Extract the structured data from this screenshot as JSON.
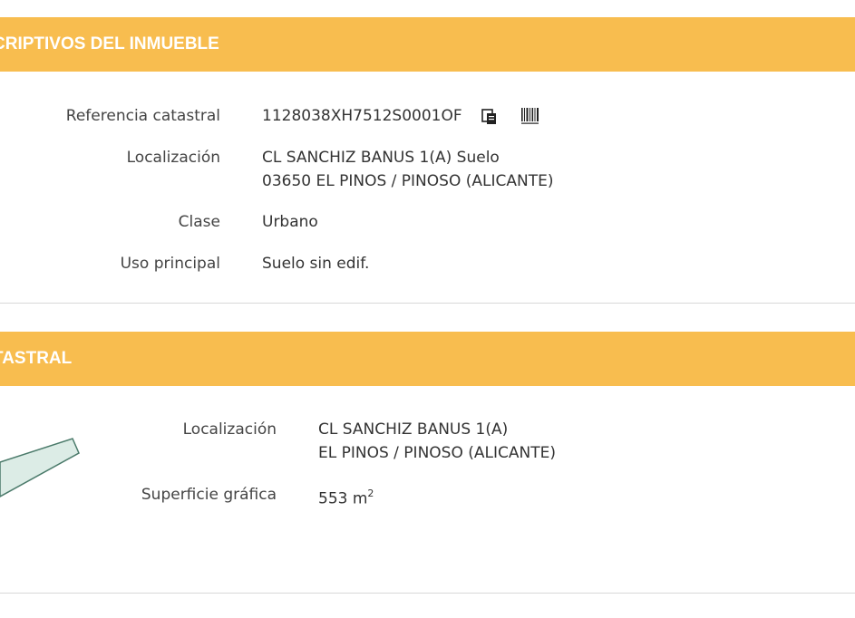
{
  "section1": {
    "title": "CRIPTIVOS DEL INMUEBLE",
    "rows": [
      {
        "label": "Referencia catastral",
        "value": "1128038XH7512S0001OF"
      },
      {
        "label": "Localización",
        "value_line1": "CL SANCHIZ BANUS 1(A) Suelo",
        "value_line2": "03650 EL PINOS / PINOSO (ALICANTE)"
      },
      {
        "label": "Clase",
        "value": "Urbano"
      },
      {
        "label": "Uso principal",
        "value": "Suelo sin edif."
      }
    ],
    "icons": [
      "copy-icon",
      "barcode-icon"
    ]
  },
  "section2": {
    "title": "TASTRAL",
    "rows": [
      {
        "label": "Localización",
        "value_line1": "CL SANCHIZ BANUS 1(A)",
        "value_line2": "EL PINOS / PINOSO (ALICANTE)"
      },
      {
        "label": "Superficie gráfica",
        "value": "553 m",
        "unit_sup": "2"
      }
    ]
  },
  "colors": {
    "header_bg": "#f8bd4f",
    "header_text": "#ffffff",
    "parcel_fill": "#dcece6",
    "parcel_stroke": "#4a7a6a"
  }
}
